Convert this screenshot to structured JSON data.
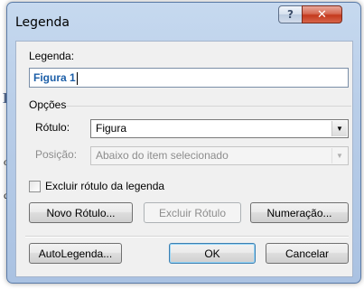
{
  "background": {
    "frag_l": "L",
    "frag_o": "o",
    "frag_c": "c"
  },
  "dialog": {
    "title": "Legenda",
    "help_glyph": "?",
    "close_glyph": "✕"
  },
  "caption": {
    "label": "Legenda:",
    "value": "Figura 1"
  },
  "options": {
    "group_label": "Opções",
    "rotulo_label": "Rótulo:",
    "rotulo_value": "Figura",
    "posicao_label": "Posição:",
    "posicao_value": "Abaixo do item selecionado",
    "exclude_label": "Excluir rótulo da legenda",
    "exclude_checked": false
  },
  "buttons": {
    "new_label": "Novo Rótulo...",
    "delete_label": "Excluir Rótulo",
    "numbering": "Numeração...",
    "autocaption": "AutoLegenda...",
    "ok": "OK",
    "cancel": "Cancelar"
  }
}
